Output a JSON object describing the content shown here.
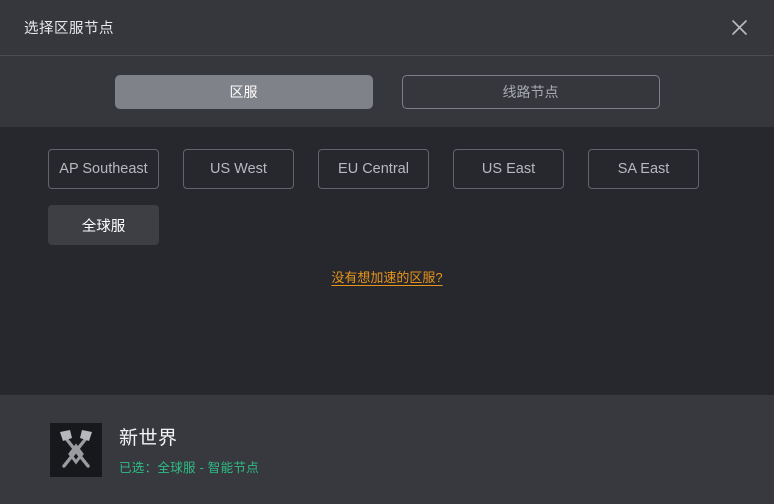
{
  "titlebar": {
    "title": "选择区服节点",
    "close_icon": "close-icon"
  },
  "tabs": [
    {
      "label": "区服",
      "active": true
    },
    {
      "label": "线路节点",
      "active": false
    }
  ],
  "regions": [
    {
      "label": "AP Southeast",
      "selected": false
    },
    {
      "label": "US West",
      "selected": false
    },
    {
      "label": "EU Central",
      "selected": false
    },
    {
      "label": "US East",
      "selected": false
    },
    {
      "label": "SA East",
      "selected": false
    },
    {
      "label": "全球服",
      "selected": true
    }
  ],
  "help_link": "没有想加速的区服?",
  "footer": {
    "game_icon": "crossed-axes-icon",
    "game_name": "新世界",
    "status": "已选：全球服 - 智能节点"
  },
  "colors": {
    "accent_link": "#e8941a",
    "status_green": "#2fbd84",
    "tab_active_bg": "#808289",
    "titlebar_bg": "#35373d",
    "content_bg": "#27282d",
    "footer_bg": "#37393f"
  }
}
